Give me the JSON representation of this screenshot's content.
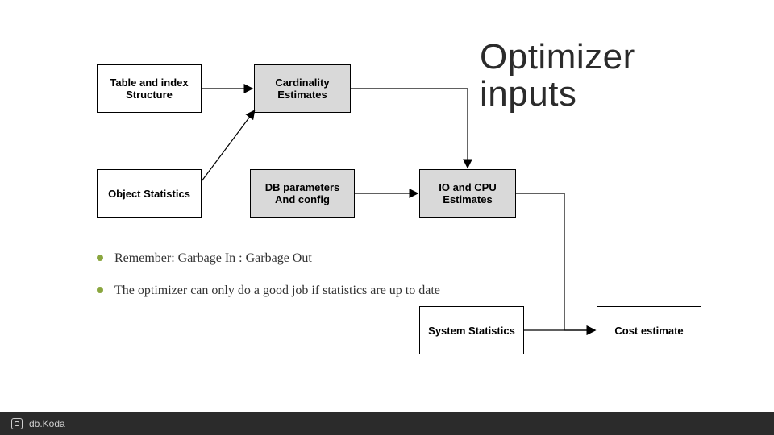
{
  "title_line1": "Optimizer",
  "title_line2": "inputs",
  "boxes": {
    "table_index": "Table and index\nStructure",
    "cardinality": "Cardinality\nEstimates",
    "object_stats": "Object Statistics",
    "db_params": "DB parameters\nAnd config",
    "io_cpu": "IO and CPU\nEstimates",
    "system_stats": "System Statistics",
    "cost_estimate": "Cost estimate"
  },
  "bullets": {
    "b1": "Remember: Garbage In : Garbage Out",
    "b2": "The optimizer can only do a good job if statistics are up to date"
  },
  "footer": "db.Koda"
}
